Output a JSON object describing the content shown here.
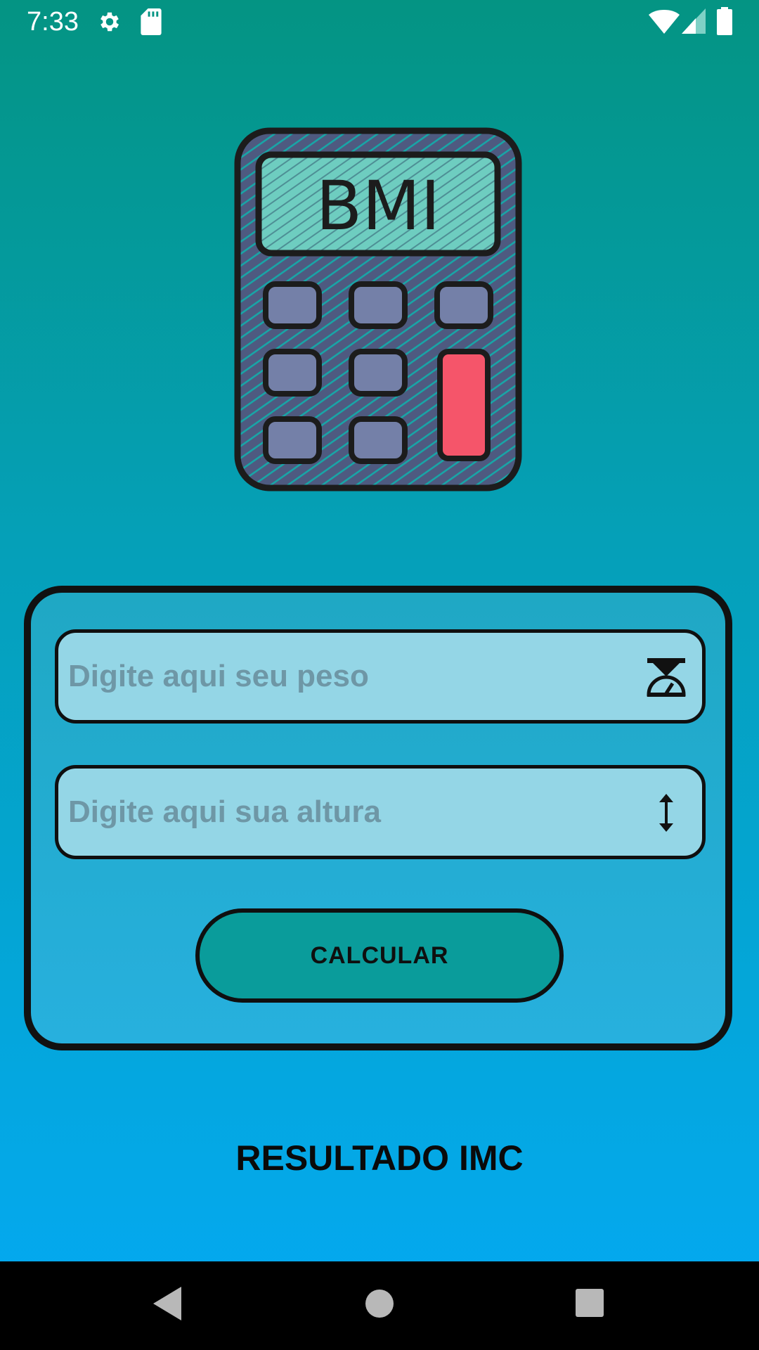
{
  "status_bar": {
    "time": "7:33",
    "icons": [
      "gear-icon",
      "sd-card-icon",
      "wifi-icon",
      "signal-icon",
      "battery-icon"
    ]
  },
  "logo": {
    "text": "BMI",
    "colors": {
      "body": "#4e5a80",
      "screen": "#6ecdc0",
      "keys": "#7480a8",
      "accent_key": "#f5556a",
      "outline": "#1c1c1c"
    }
  },
  "form": {
    "weight_input": {
      "placeholder": "Digite aqui seu peso",
      "value": "",
      "icon": "scale-icon"
    },
    "height_input": {
      "placeholder": "Digite aqui sua altura",
      "value": "",
      "icon": "vertical-arrows-icon"
    },
    "calculate_button_label": "CALCULAR"
  },
  "result": {
    "label": "RESULTADO IMC"
  },
  "nav_bar": {
    "icons": [
      "back-icon",
      "home-icon",
      "recents-icon"
    ]
  },
  "colors": {
    "gradient_top": "#049483",
    "gradient_bottom": "#03a9f4",
    "field_background": "#94d6e6",
    "button_background": "#0a9c9b"
  }
}
